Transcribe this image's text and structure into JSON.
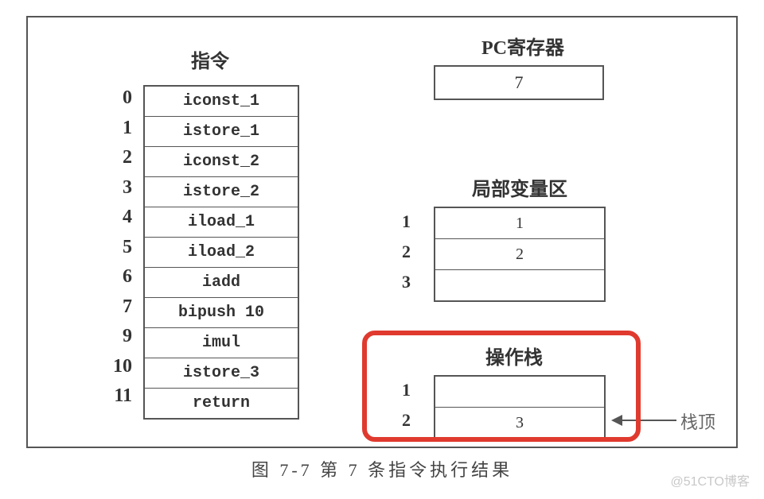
{
  "instruction": {
    "title": "指令",
    "rows": [
      {
        "idx": "0",
        "op": "iconst_1"
      },
      {
        "idx": "1",
        "op": "istore_1"
      },
      {
        "idx": "2",
        "op": "iconst_2"
      },
      {
        "idx": "3",
        "op": "istore_2"
      },
      {
        "idx": "4",
        "op": "iload_1"
      },
      {
        "idx": "5",
        "op": "iload_2"
      },
      {
        "idx": "6",
        "op": "iadd"
      },
      {
        "idx": "7",
        "op": "bipush  10"
      },
      {
        "idx": "9",
        "op": "imul"
      },
      {
        "idx": "10",
        "op": "istore_3"
      },
      {
        "idx": "11",
        "op": "return"
      }
    ]
  },
  "pc": {
    "title": "PC寄存器",
    "value": "7"
  },
  "local_vars": {
    "title": "局部变量区",
    "rows": [
      {
        "idx": "1",
        "val": "1"
      },
      {
        "idx": "2",
        "val": "2"
      },
      {
        "idx": "3",
        "val": ""
      }
    ]
  },
  "stack": {
    "title": "操作栈",
    "rows": [
      {
        "idx": "1",
        "val": ""
      },
      {
        "idx": "2",
        "val": "3"
      }
    ],
    "top_label": "栈顶"
  },
  "caption": "图 7-7  第 7 条指令执行结果",
  "watermark": "@51CTO博客"
}
